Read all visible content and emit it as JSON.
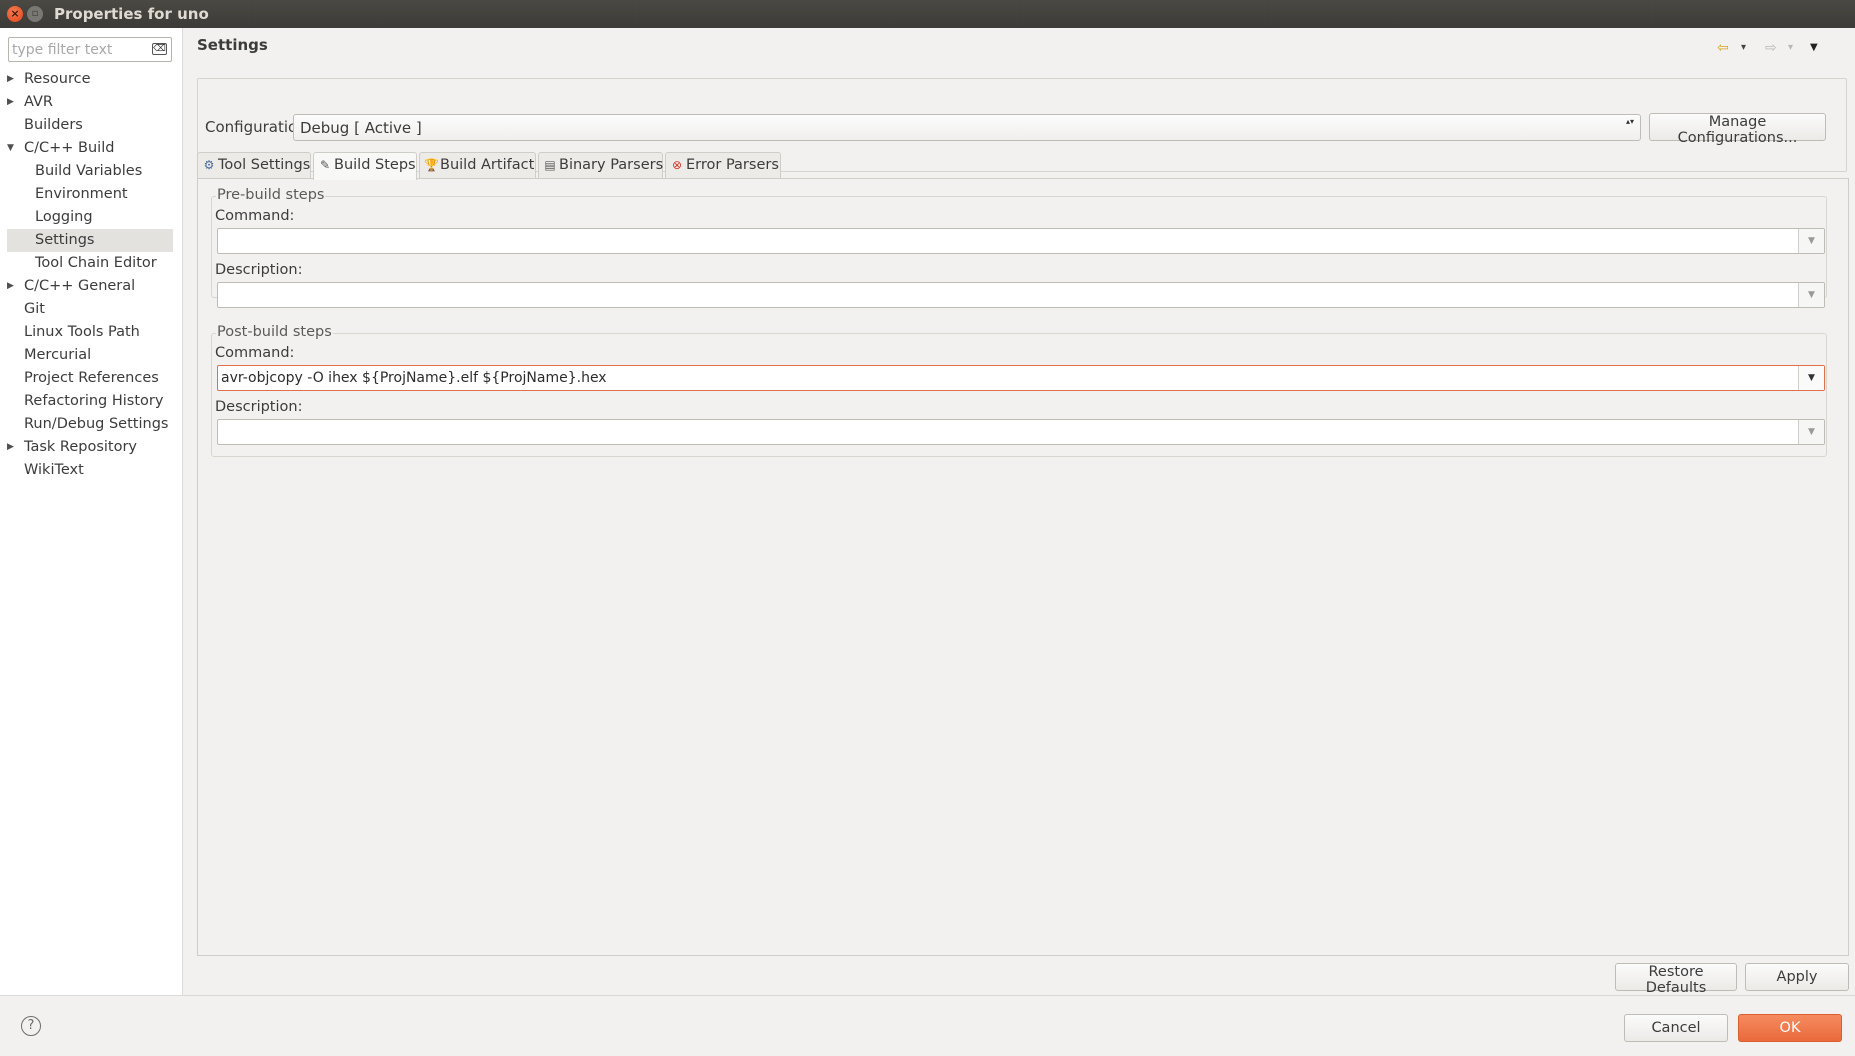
{
  "window": {
    "title": "Properties for uno",
    "close_glyph": "×",
    "max_glyph": "▫"
  },
  "sidebar": {
    "filter_placeholder": "type filter text",
    "clear_icon_glyph": "⌫",
    "expand_glyph": "▶",
    "collapse_glyph": "▼",
    "items": [
      {
        "label": "Resource",
        "level": 0,
        "arrow": "collapsed"
      },
      {
        "label": "AVR",
        "level": 0,
        "arrow": "collapsed"
      },
      {
        "label": "Builders",
        "level": 0,
        "arrow": "none"
      },
      {
        "label": "C/C++ Build",
        "level": 0,
        "arrow": "expanded"
      },
      {
        "label": "Build Variables",
        "level": 1,
        "arrow": "none"
      },
      {
        "label": "Environment",
        "level": 1,
        "arrow": "none"
      },
      {
        "label": "Logging",
        "level": 1,
        "arrow": "none"
      },
      {
        "label": "Settings",
        "level": 1,
        "arrow": "none",
        "selected": true
      },
      {
        "label": "Tool Chain Editor",
        "level": 1,
        "arrow": "none"
      },
      {
        "label": "C/C++ General",
        "level": 0,
        "arrow": "collapsed"
      },
      {
        "label": "Git",
        "level": 0,
        "arrow": "none"
      },
      {
        "label": "Linux Tools Path",
        "level": 0,
        "arrow": "none"
      },
      {
        "label": "Mercurial",
        "level": 0,
        "arrow": "none"
      },
      {
        "label": "Project References",
        "level": 0,
        "arrow": "none"
      },
      {
        "label": "Refactoring History",
        "level": 0,
        "arrow": "none"
      },
      {
        "label": "Run/Debug Settings",
        "level": 0,
        "arrow": "none"
      },
      {
        "label": "Task Repository",
        "level": 0,
        "arrow": "collapsed"
      },
      {
        "label": "WikiText",
        "level": 0,
        "arrow": "none"
      }
    ]
  },
  "main": {
    "page_title": "Settings",
    "nav": {
      "back_glyph": "⇦",
      "forward_glyph": "⇨",
      "dropdown_glyph": "▾",
      "menu_glyph": "▼"
    },
    "configuration": {
      "label": "Configuration:",
      "selected": "Debug  [ Active ]",
      "spin_glyph": "▴▾",
      "manage_label": "Manage Configurations..."
    },
    "tabs": [
      {
        "label": "Tool Settings",
        "icon": "tool-settings-icon",
        "glyph": "⚙",
        "color": "#4a6a9a"
      },
      {
        "label": "Build Steps",
        "icon": "build-steps-icon",
        "glyph": "✎",
        "color": "#555555",
        "active": true
      },
      {
        "label": "Build Artifact",
        "icon": "build-artifact-icon",
        "glyph": "🏆",
        "color": "#d9a21b"
      },
      {
        "label": "Binary Parsers",
        "icon": "binary-parsers-icon",
        "glyph": "▤",
        "color": "#5a5a5a"
      },
      {
        "label": "Error Parsers",
        "icon": "error-parsers-icon",
        "glyph": "⊗",
        "color": "#d23a2a"
      }
    ],
    "pre_build": {
      "title": "Pre-build steps",
      "command_label": "Command:",
      "command_value": "",
      "description_label": "Description:",
      "description_value": ""
    },
    "post_build": {
      "title": "Post-build steps",
      "command_label": "Command:",
      "command_value": "avr-objcopy -O ihex ${ProjName}.elf ${ProjName}.hex",
      "description_label": "Description:",
      "description_value": ""
    },
    "combo_drop_glyph": "▼",
    "restore_defaults_label": "Restore Defaults",
    "apply_label": "Apply"
  },
  "footer": {
    "help_glyph": "?",
    "cancel_label": "Cancel",
    "ok_label": "OK"
  },
  "colors": {
    "accent": "#ea6a3c",
    "focus_border": "#e0704a",
    "back_arrow": "#d9a21b"
  }
}
